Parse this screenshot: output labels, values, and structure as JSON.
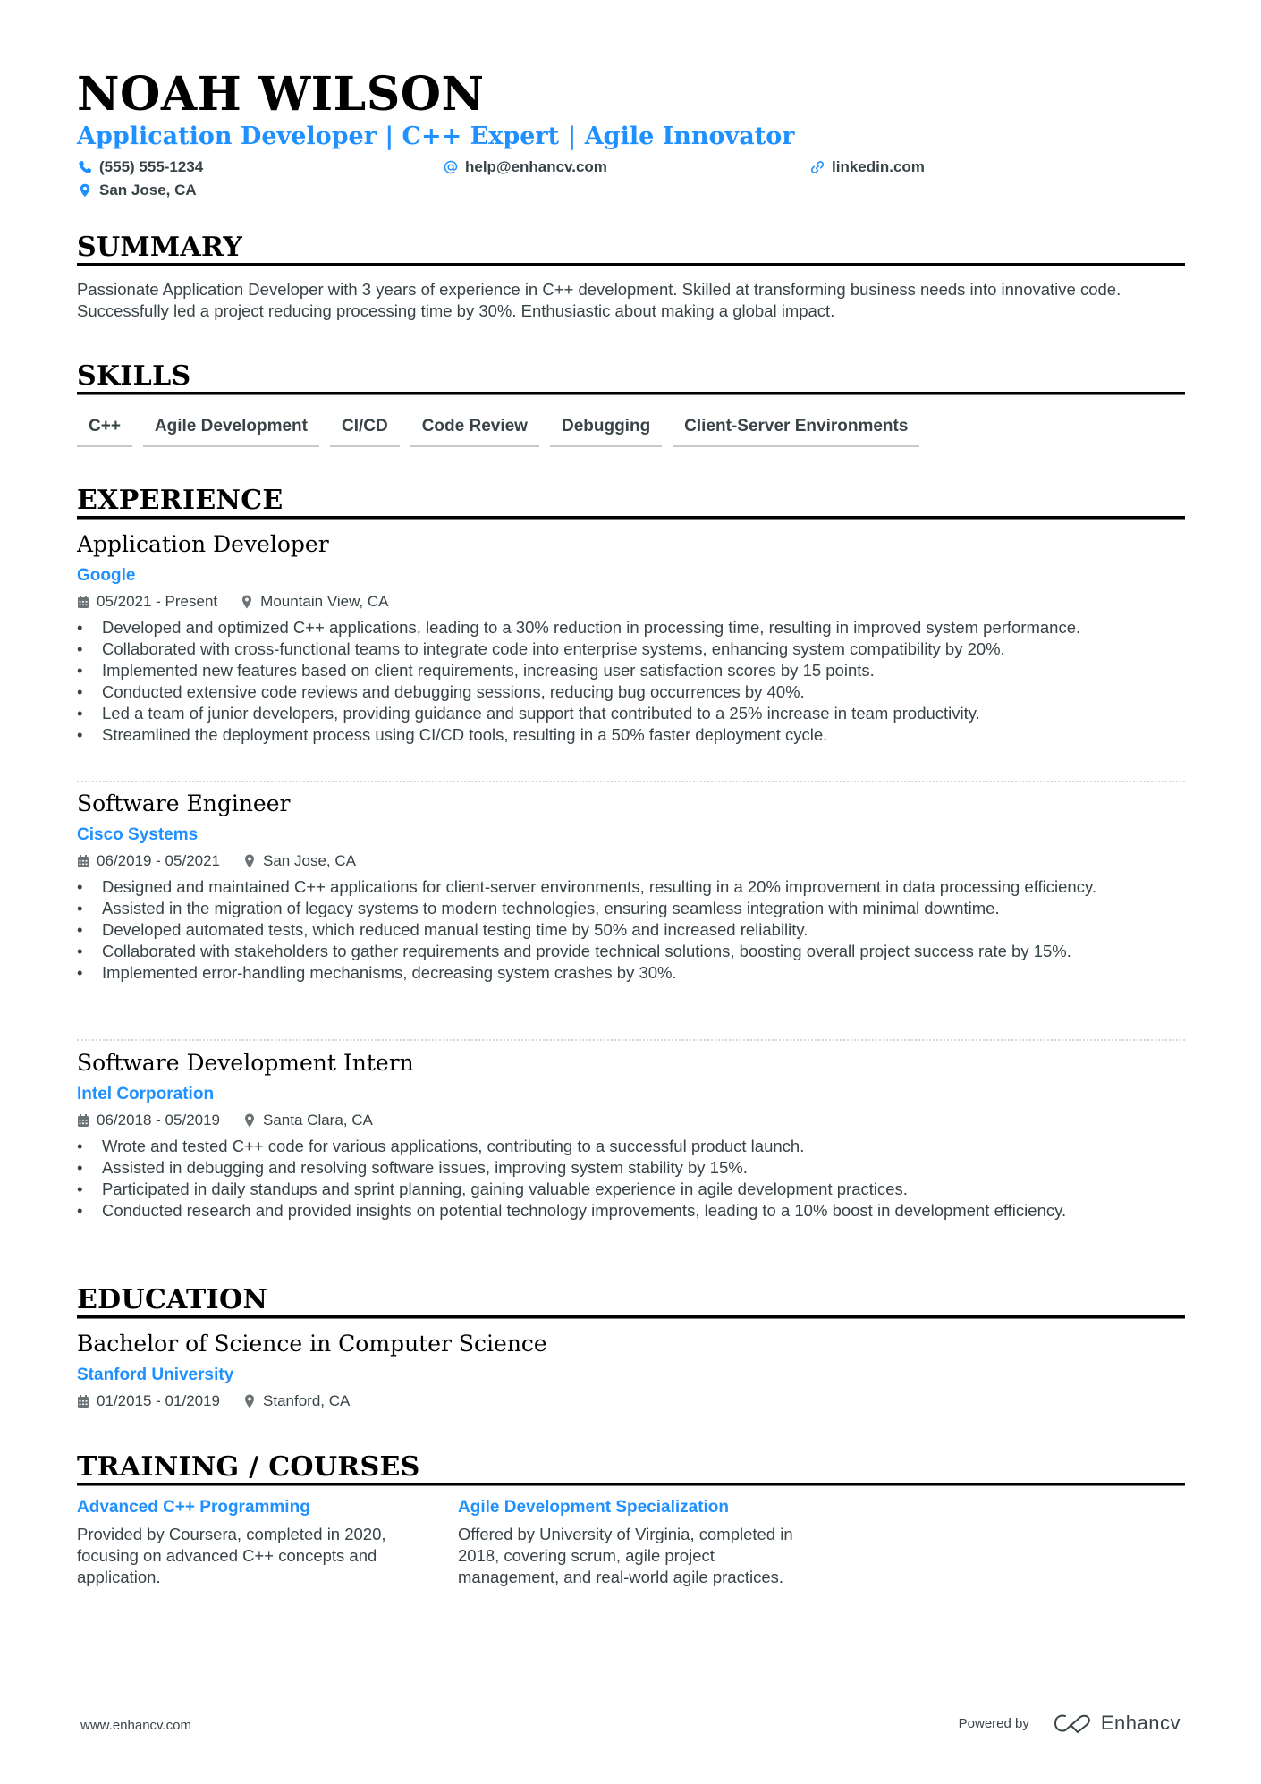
{
  "header": {
    "name": "NOAH WILSON",
    "headline": "Application Developer | C++ Expert | Agile Innovator",
    "contacts": [
      {
        "icon": "phone-icon",
        "value": "(555) 555-1234"
      },
      {
        "icon": "at-icon",
        "value": "help@enhancv.com"
      },
      {
        "icon": "link-icon",
        "value": "linkedin.com"
      },
      {
        "icon": "location-icon",
        "value": "San Jose, CA"
      }
    ]
  },
  "colors": {
    "accent": "#1E90FF",
    "text": "#384347",
    "heading": "#000000"
  },
  "summary": {
    "title": "SUMMARY",
    "text": "Passionate Application Developer with 3 years of experience in C++ development. Skilled at transforming business needs into innovative code. Successfully led a project reducing processing time by 30%. Enthusiastic about making a global impact."
  },
  "skills": {
    "title": "SKILLS",
    "items": [
      "C++",
      "Agile Development",
      "CI/CD",
      "Code Review",
      "Debugging",
      "Client-Server Environments"
    ]
  },
  "experience": {
    "title": "EXPERIENCE",
    "jobs": [
      {
        "title": "Application Developer",
        "company": "Google",
        "dates": "05/2021 - Present",
        "location": "Mountain View, CA",
        "bullets": [
          "Developed and optimized C++ applications, leading to a 30% reduction in processing time, resulting in improved system performance.",
          "Collaborated with cross-functional teams to integrate code into enterprise systems, enhancing system compatibility by 20%.",
          "Implemented new features based on client requirements, increasing user satisfaction scores by 15 points.",
          "Conducted extensive code reviews and debugging sessions, reducing bug occurrences by 40%.",
          "Led a team of junior developers, providing guidance and support that contributed to a 25% increase in team productivity.",
          "Streamlined the deployment process using CI/CD tools, resulting in a 50% faster deployment cycle."
        ]
      },
      {
        "title": "Software Engineer",
        "company": "Cisco Systems",
        "dates": "06/2019 - 05/2021",
        "location": "San Jose, CA",
        "bullets": [
          "Designed and maintained C++ applications for client-server environments, resulting in a 20% improvement in data processing efficiency.",
          "Assisted in the migration of legacy systems to modern technologies, ensuring seamless integration with minimal downtime.",
          "Developed automated tests, which reduced manual testing time by 50% and increased reliability.",
          "Collaborated with stakeholders to gather requirements and provide technical solutions, boosting overall project success rate by 15%.",
          "Implemented error-handling mechanisms, decreasing system crashes by 30%."
        ]
      },
      {
        "title": "Software Development Intern",
        "company": "Intel Corporation",
        "dates": "06/2018 - 05/2019",
        "location": "Santa Clara, CA",
        "bullets": [
          "Wrote and tested C++ code for various applications, contributing to a successful product launch.",
          "Assisted in debugging and resolving software issues, improving system stability by 15%.",
          "Participated in daily standups and sprint planning, gaining valuable experience in agile development practices.",
          "Conducted research and provided insights on potential technology improvements, leading to a 10% boost in development efficiency."
        ]
      }
    ]
  },
  "education": {
    "title": "EDUCATION",
    "degree": "Bachelor of Science in Computer Science",
    "school": "Stanford University",
    "dates": "01/2015 - 01/2019",
    "location": "Stanford, CA"
  },
  "training": {
    "title": "TRAINING / COURSES",
    "courses": [
      {
        "title": "Advanced C++ Programming",
        "description": "Provided by Coursera, completed in 2020, focusing on advanced C++ concepts and application."
      },
      {
        "title": "Agile Development Specialization",
        "description": "Offered by University of Virginia, completed in 2018, covering scrum, agile project management, and real-world agile practices."
      }
    ]
  },
  "footer": {
    "website": "www.enhancv.com",
    "powered_by": "Powered by",
    "brand": "Enhancv"
  }
}
